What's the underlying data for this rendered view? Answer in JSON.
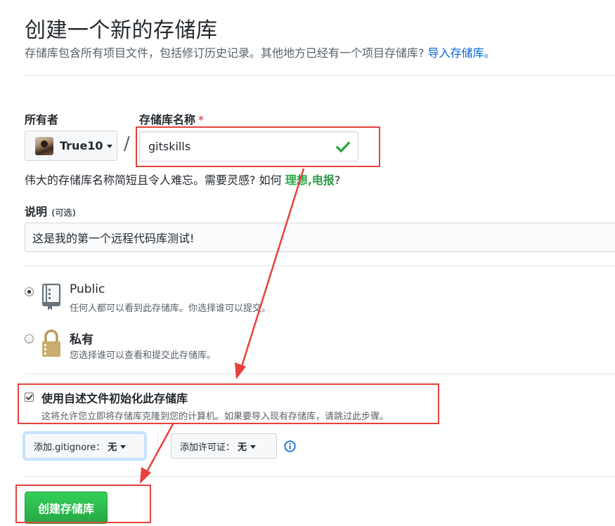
{
  "header": {
    "title": "创建一个新的存储库",
    "subtitle": "存储库包含所有项目文件，包括修订历史记录。其他地方已经有一个项目存储库?",
    "import_link": "导入存储库。"
  },
  "owner": {
    "label": "所有者",
    "value": "True10"
  },
  "repo_name": {
    "label": "存储库名称",
    "required_mark": "*",
    "value": "gitskills",
    "valid": true
  },
  "name_hint": {
    "prefix": "伟大的存储库名称简短且令人难忘。需要灵感? 如何",
    "suggestion1": "理想,",
    "suggestion2": "电报",
    "suffix": "?"
  },
  "description": {
    "label": "说明",
    "optional": "(可选)",
    "value": "这是我的第一个远程代码库测试!"
  },
  "visibility": {
    "options": [
      {
        "title": "Public",
        "desc": "任何人都可以看到此存储库。你选择谁可以提交。",
        "icon": "repo-book-icon",
        "checked": true
      },
      {
        "title": "私有",
        "desc": "您选择谁可以查看和提交此存储库。",
        "icon": "lock-icon",
        "checked": false
      }
    ]
  },
  "init": {
    "checked": true,
    "title": "使用自述文件初始化此存储库",
    "desc": "这将允许您立即将存储库克隆到您的计算机。如果要导入现有存储库，请跳过此步骤。"
  },
  "gitignore": {
    "label": "添加.gitignore：",
    "value": "无"
  },
  "license": {
    "label": "添加许可证：",
    "value": "无"
  },
  "create_button": {
    "label": "创建存储库"
  },
  "colors": {
    "accent_green": "#28a745",
    "link_blue": "#0366d6",
    "annotation_red": "#e8413b"
  }
}
